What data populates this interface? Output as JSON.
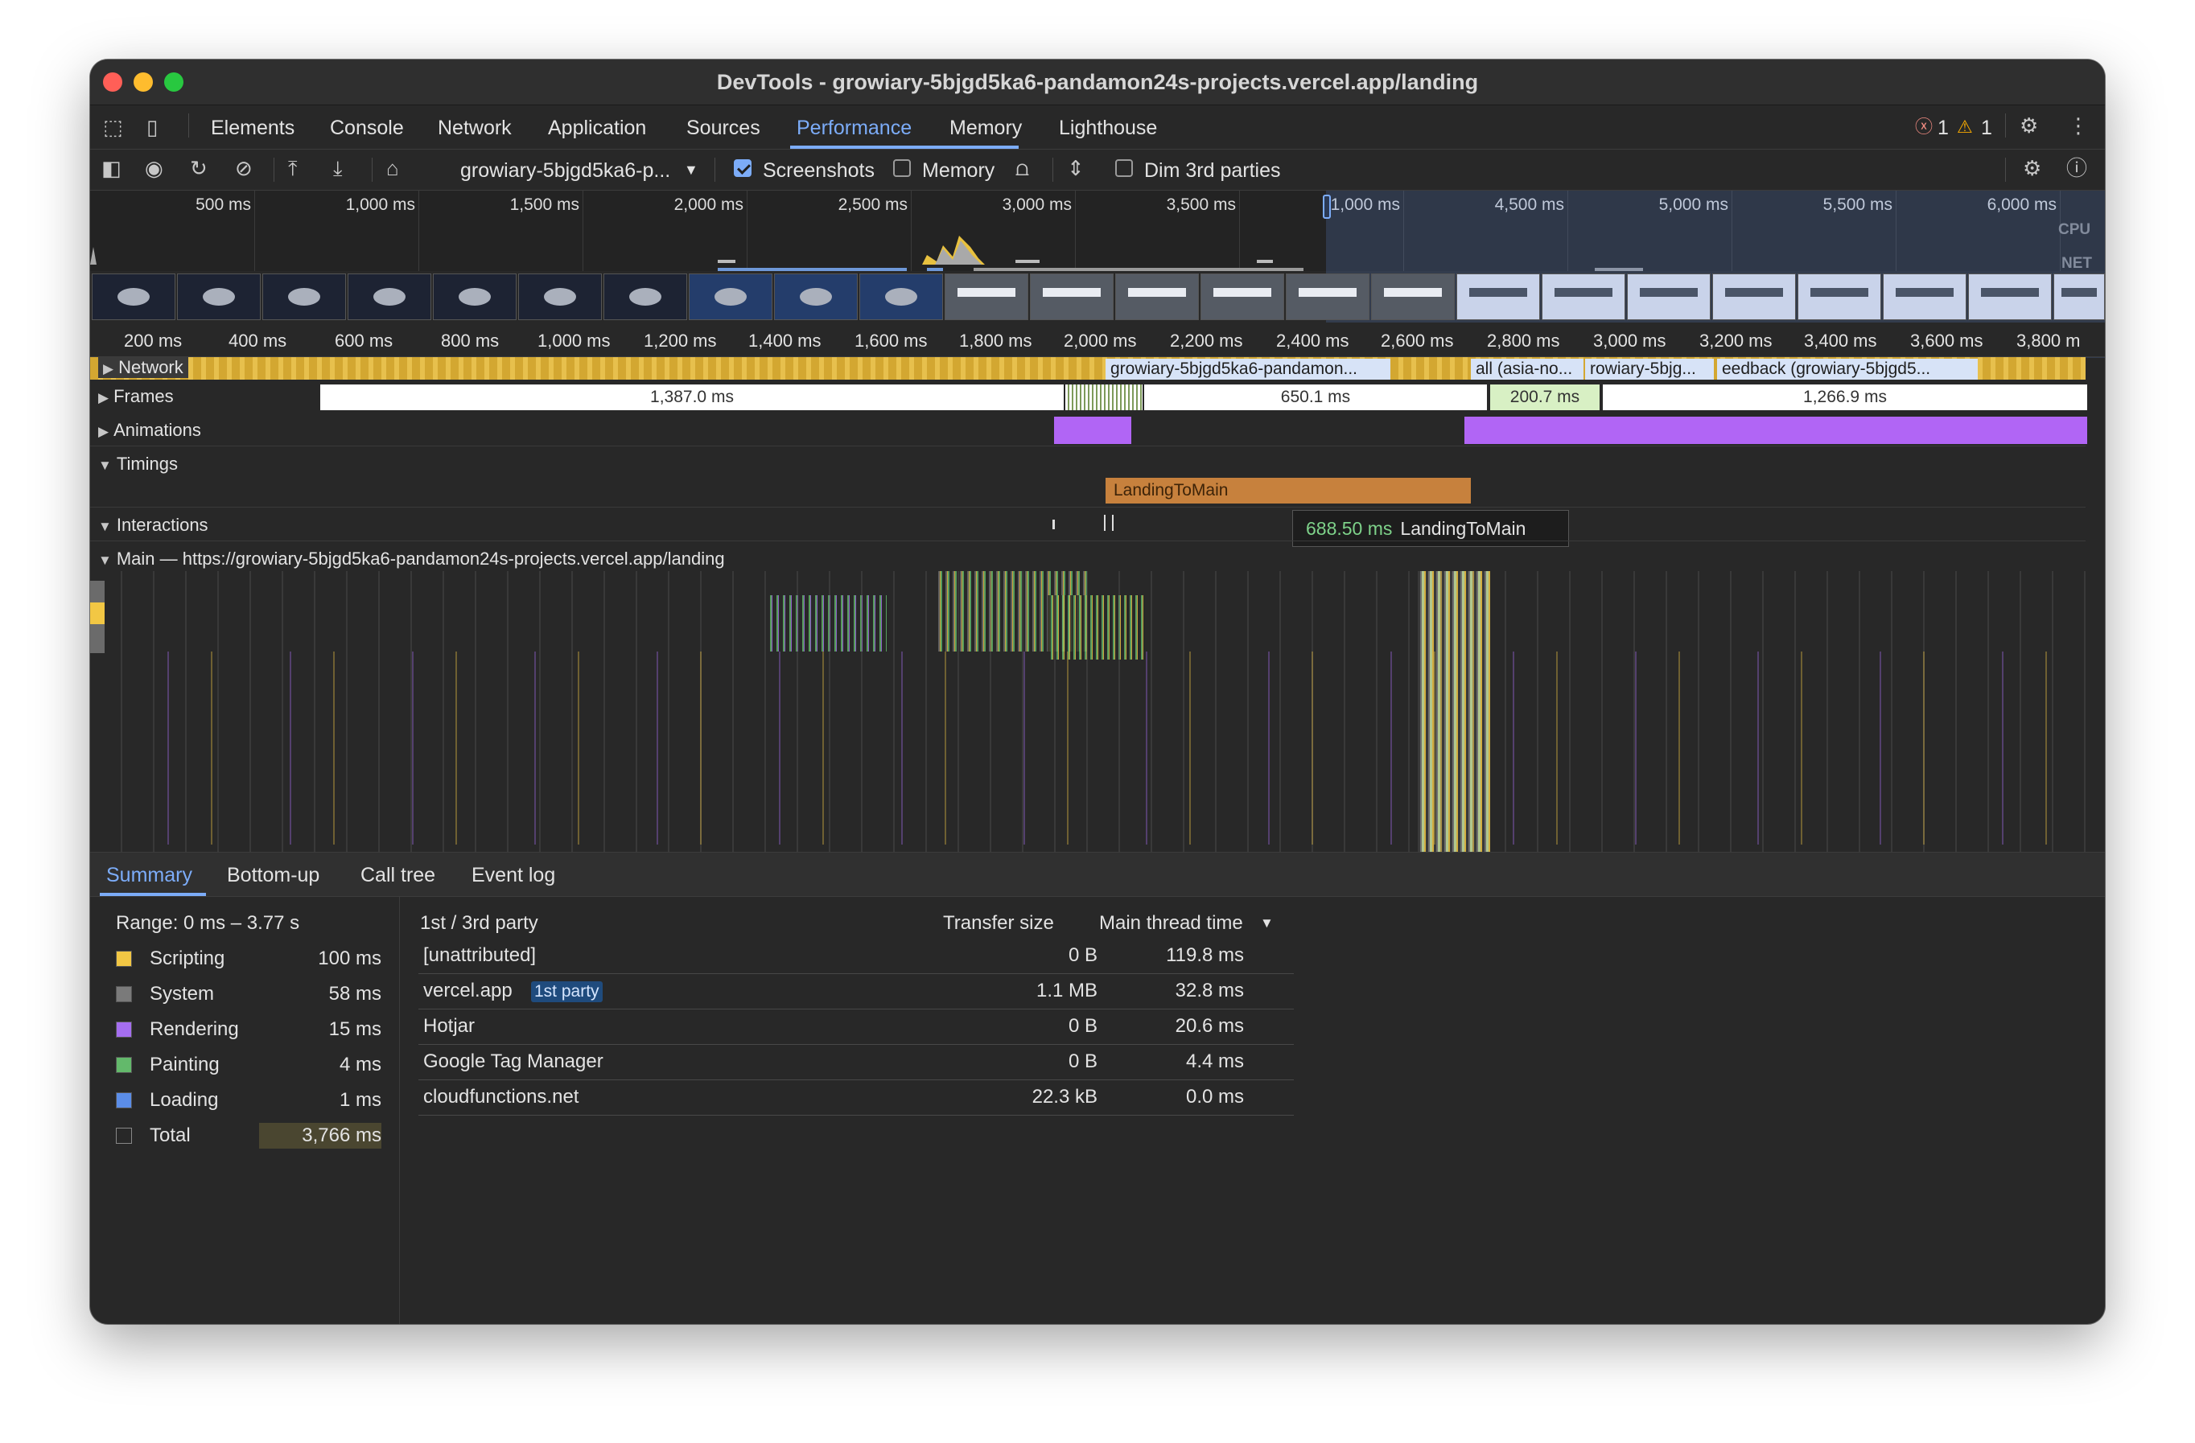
{
  "window": {
    "title": "DevTools - growiary-5bjgd5ka6-pandamon24s-projects.vercel.app/landing"
  },
  "tabs": [
    "Elements",
    "Console",
    "Network",
    "Application",
    "Sources",
    "Performance",
    "Memory",
    "Lighthouse"
  ],
  "active_tab": "Performance",
  "issues": {
    "errors": "1",
    "warnings": "1"
  },
  "toolbar": {
    "url_select": "growiary-5bjgd5ka6-p...",
    "screenshots_label": "Screenshots",
    "screenshots_checked": true,
    "memory_label": "Memory",
    "memory_checked": false,
    "dim_label": "Dim 3rd parties",
    "dim_checked": false
  },
  "overview": {
    "labels": [
      "500 ms",
      "1,000 ms",
      "1,500 ms",
      "2,000 ms",
      "2,500 ms",
      "3,000 ms",
      "3,500 ms",
      "1,000 ms",
      "4,500 ms",
      "5,000 ms",
      "5,500 ms",
      "6,000 ms"
    ],
    "cpu_label": "CPU",
    "net_label": "NET"
  },
  "ruler": [
    "200 ms",
    "400 ms",
    "600 ms",
    "800 ms",
    "1,000 ms",
    "1,200 ms",
    "1,400 ms",
    "1,600 ms",
    "1,800 ms",
    "2,000 ms",
    "2,200 ms",
    "2,400 ms",
    "2,600 ms",
    "2,800 ms",
    "3,000 ms",
    "3,200 ms",
    "3,400 ms",
    "3,600 ms",
    "3,800 m"
  ],
  "tracks": {
    "network": "Network",
    "frames": "Frames",
    "animations": "Animations",
    "timings": "Timings",
    "interactions": "Interactions",
    "main": "Main — https://growiary-5bjgd5ka6-pandamon24s-projects.vercel.app/landing"
  },
  "network_segments": [
    "growiary-5bjgd5ka6-pandamon...",
    "all (asia-no...",
    "rowiary-5bjg...",
    "eedback (growiary-5bjgd5..."
  ],
  "frames": [
    "1,387.0 ms",
    "650.1 ms",
    "200.7 ms",
    "1,266.9 ms"
  ],
  "timing": {
    "label": "LandingToMain"
  },
  "tooltip": {
    "duration": "688.50 ms",
    "name": "LandingToMain"
  },
  "bottom_tabs": [
    "Summary",
    "Bottom-up",
    "Call tree",
    "Event log"
  ],
  "summary": {
    "range": "Range: 0 ms – 3.77 s",
    "categories": [
      {
        "name": "Scripting",
        "value": "100 ms",
        "color": "#f2c744"
      },
      {
        "name": "System",
        "value": "58 ms",
        "color": "#7a7a7a"
      },
      {
        "name": "Rendering",
        "value": "15 ms",
        "color": "#a56ef0"
      },
      {
        "name": "Painting",
        "value": "4 ms",
        "color": "#63b96b"
      },
      {
        "name": "Loading",
        "value": "1 ms",
        "color": "#5b8de8"
      },
      {
        "name": "Total",
        "value": "3,766 ms",
        "color": "#282828"
      }
    ]
  },
  "party_table": {
    "headers": [
      "1st / 3rd party",
      "Transfer size",
      "Main thread time"
    ],
    "rows": [
      {
        "name": "[unattributed]",
        "badge": "",
        "size": "0 B",
        "time": "119.8 ms"
      },
      {
        "name": "vercel.app",
        "badge": "1st party",
        "size": "1.1 MB",
        "time": "32.8 ms"
      },
      {
        "name": "Hotjar",
        "badge": "",
        "size": "0 B",
        "time": "20.6 ms"
      },
      {
        "name": "Google Tag Manager",
        "badge": "",
        "size": "0 B",
        "time": "4.4 ms"
      },
      {
        "name": "cloudfunctions.net",
        "badge": "",
        "size": "22.3 kB",
        "time": "0.0 ms"
      }
    ]
  }
}
